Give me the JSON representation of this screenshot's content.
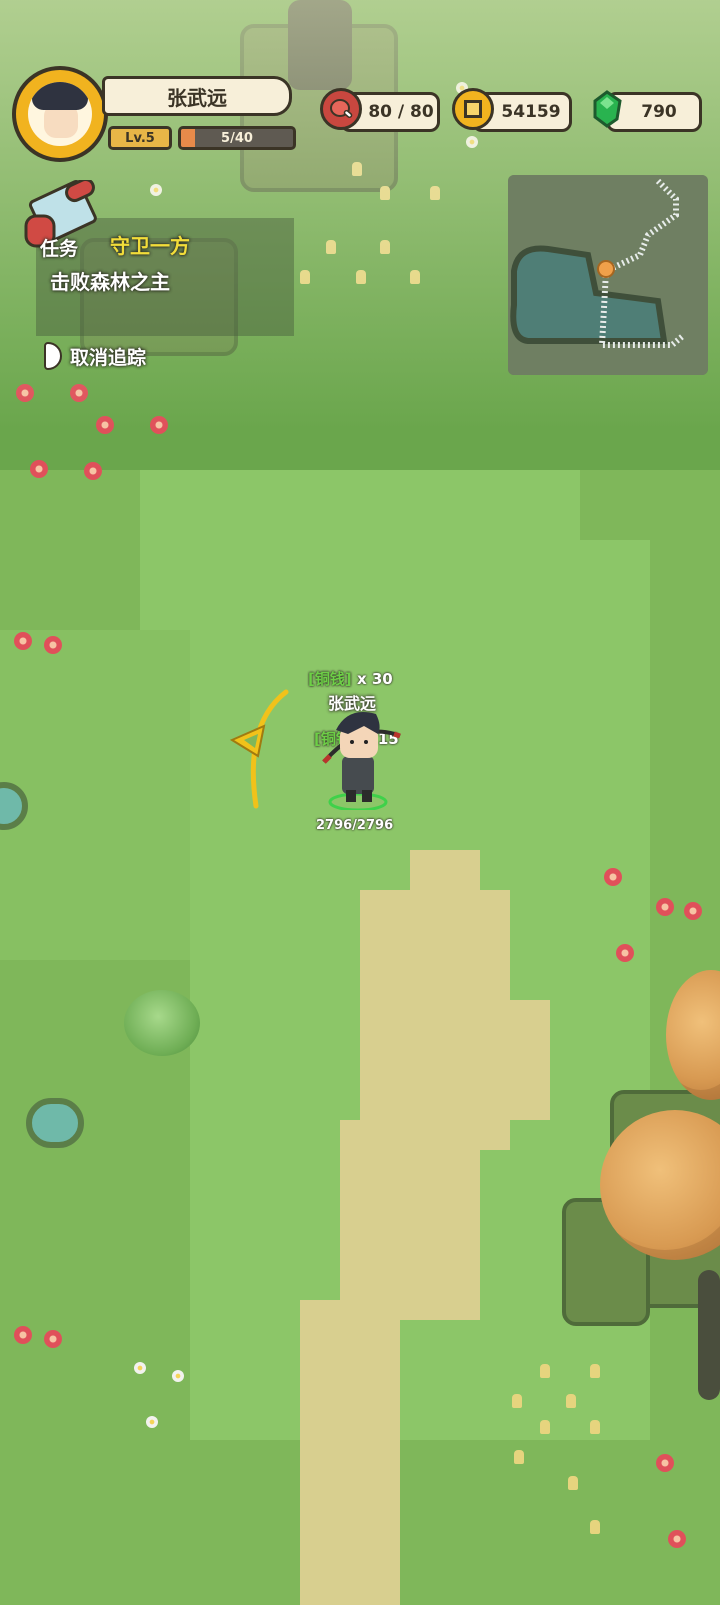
{
  "hud": {
    "player_name": "张武远",
    "level": "Lv.5",
    "exp": "5/40",
    "exp_progress": 0.125,
    "stamina": "80 / 80",
    "coins": "54159",
    "gems": "790",
    "icons": {
      "stamina": "meat-icon",
      "coins": "coin-icon",
      "gems": "gem-icon"
    }
  },
  "quest": {
    "label": "任务",
    "title": "守卫一方",
    "description": "击败森林之主",
    "cancel_label": "取消追踪"
  },
  "player": {
    "name": "张武远",
    "hp": "2796/2796",
    "loot": [
      {
        "item": "铜钱",
        "count": "x 30"
      },
      {
        "item": "铜钱",
        "count": "x 15"
      }
    ]
  },
  "colors": {
    "quest_title": "#f2dd3a",
    "loot_tag": "#6dcf46",
    "hud_frame": "#3b3426",
    "gold": "#f1b31f"
  }
}
